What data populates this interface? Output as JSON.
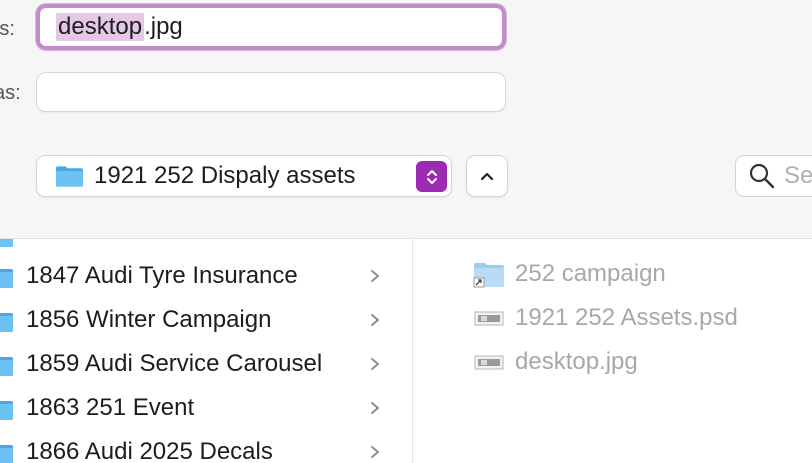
{
  "save_dialog": {
    "save_as_label": "As:",
    "save_as_selected": "desktop",
    "save_as_rest": ".jpg",
    "tags_label": "as:",
    "tags_value": "",
    "location": "1921 252 Dispaly assets",
    "search_placeholder": "Se"
  },
  "colors": {
    "accent": "#9b2bb0",
    "focus_ring": "#c08ec7",
    "selection": "#e4c8e6",
    "folder_blue": "#5fb8ef"
  },
  "column1": {
    "items": [
      {
        "name": "1847 Audi Tyre Insurance",
        "icon": "folder-icon"
      },
      {
        "name": "1856 Winter Campaign",
        "icon": "folder-icon"
      },
      {
        "name": "1859 Audi Service Carousel",
        "icon": "folder-icon"
      },
      {
        "name": "1863 251 Event",
        "icon": "folder-icon"
      },
      {
        "name": "1866 Audi 2025 Decals",
        "icon": "folder-icon"
      }
    ]
  },
  "column2": {
    "items": [
      {
        "name": "252 campaign",
        "icon": "folder-alias-icon"
      },
      {
        "name": "1921 252 Assets.psd",
        "icon": "image-file-icon"
      },
      {
        "name": "desktop.jpg",
        "icon": "image-file-icon"
      }
    ]
  }
}
